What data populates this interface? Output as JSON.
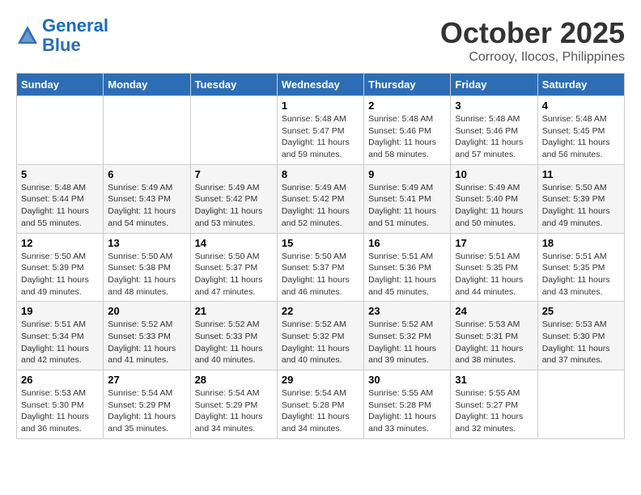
{
  "header": {
    "logo_line1": "General",
    "logo_line2": "Blue",
    "month": "October 2025",
    "location": "Corrooy, Ilocos, Philippines"
  },
  "weekdays": [
    "Sunday",
    "Monday",
    "Tuesday",
    "Wednesday",
    "Thursday",
    "Friday",
    "Saturday"
  ],
  "weeks": [
    [
      {
        "day": "",
        "info": ""
      },
      {
        "day": "",
        "info": ""
      },
      {
        "day": "",
        "info": ""
      },
      {
        "day": "1",
        "info": "Sunrise: 5:48 AM\nSunset: 5:47 PM\nDaylight: 11 hours\nand 59 minutes."
      },
      {
        "day": "2",
        "info": "Sunrise: 5:48 AM\nSunset: 5:46 PM\nDaylight: 11 hours\nand 58 minutes."
      },
      {
        "day": "3",
        "info": "Sunrise: 5:48 AM\nSunset: 5:46 PM\nDaylight: 11 hours\nand 57 minutes."
      },
      {
        "day": "4",
        "info": "Sunrise: 5:48 AM\nSunset: 5:45 PM\nDaylight: 11 hours\nand 56 minutes."
      }
    ],
    [
      {
        "day": "5",
        "info": "Sunrise: 5:48 AM\nSunset: 5:44 PM\nDaylight: 11 hours\nand 55 minutes."
      },
      {
        "day": "6",
        "info": "Sunrise: 5:49 AM\nSunset: 5:43 PM\nDaylight: 11 hours\nand 54 minutes."
      },
      {
        "day": "7",
        "info": "Sunrise: 5:49 AM\nSunset: 5:42 PM\nDaylight: 11 hours\nand 53 minutes."
      },
      {
        "day": "8",
        "info": "Sunrise: 5:49 AM\nSunset: 5:42 PM\nDaylight: 11 hours\nand 52 minutes."
      },
      {
        "day": "9",
        "info": "Sunrise: 5:49 AM\nSunset: 5:41 PM\nDaylight: 11 hours\nand 51 minutes."
      },
      {
        "day": "10",
        "info": "Sunrise: 5:49 AM\nSunset: 5:40 PM\nDaylight: 11 hours\nand 50 minutes."
      },
      {
        "day": "11",
        "info": "Sunrise: 5:50 AM\nSunset: 5:39 PM\nDaylight: 11 hours\nand 49 minutes."
      }
    ],
    [
      {
        "day": "12",
        "info": "Sunrise: 5:50 AM\nSunset: 5:39 PM\nDaylight: 11 hours\nand 49 minutes."
      },
      {
        "day": "13",
        "info": "Sunrise: 5:50 AM\nSunset: 5:38 PM\nDaylight: 11 hours\nand 48 minutes."
      },
      {
        "day": "14",
        "info": "Sunrise: 5:50 AM\nSunset: 5:37 PM\nDaylight: 11 hours\nand 47 minutes."
      },
      {
        "day": "15",
        "info": "Sunrise: 5:50 AM\nSunset: 5:37 PM\nDaylight: 11 hours\nand 46 minutes."
      },
      {
        "day": "16",
        "info": "Sunrise: 5:51 AM\nSunset: 5:36 PM\nDaylight: 11 hours\nand 45 minutes."
      },
      {
        "day": "17",
        "info": "Sunrise: 5:51 AM\nSunset: 5:35 PM\nDaylight: 11 hours\nand 44 minutes."
      },
      {
        "day": "18",
        "info": "Sunrise: 5:51 AM\nSunset: 5:35 PM\nDaylight: 11 hours\nand 43 minutes."
      }
    ],
    [
      {
        "day": "19",
        "info": "Sunrise: 5:51 AM\nSunset: 5:34 PM\nDaylight: 11 hours\nand 42 minutes."
      },
      {
        "day": "20",
        "info": "Sunrise: 5:52 AM\nSunset: 5:33 PM\nDaylight: 11 hours\nand 41 minutes."
      },
      {
        "day": "21",
        "info": "Sunrise: 5:52 AM\nSunset: 5:33 PM\nDaylight: 11 hours\nand 40 minutes."
      },
      {
        "day": "22",
        "info": "Sunrise: 5:52 AM\nSunset: 5:32 PM\nDaylight: 11 hours\nand 40 minutes."
      },
      {
        "day": "23",
        "info": "Sunrise: 5:52 AM\nSunset: 5:32 PM\nDaylight: 11 hours\nand 39 minutes."
      },
      {
        "day": "24",
        "info": "Sunrise: 5:53 AM\nSunset: 5:31 PM\nDaylight: 11 hours\nand 38 minutes."
      },
      {
        "day": "25",
        "info": "Sunrise: 5:53 AM\nSunset: 5:30 PM\nDaylight: 11 hours\nand 37 minutes."
      }
    ],
    [
      {
        "day": "26",
        "info": "Sunrise: 5:53 AM\nSunset: 5:30 PM\nDaylight: 11 hours\nand 36 minutes."
      },
      {
        "day": "27",
        "info": "Sunrise: 5:54 AM\nSunset: 5:29 PM\nDaylight: 11 hours\nand 35 minutes."
      },
      {
        "day": "28",
        "info": "Sunrise: 5:54 AM\nSunset: 5:29 PM\nDaylight: 11 hours\nand 34 minutes."
      },
      {
        "day": "29",
        "info": "Sunrise: 5:54 AM\nSunset: 5:28 PM\nDaylight: 11 hours\nand 34 minutes."
      },
      {
        "day": "30",
        "info": "Sunrise: 5:55 AM\nSunset: 5:28 PM\nDaylight: 11 hours\nand 33 minutes."
      },
      {
        "day": "31",
        "info": "Sunrise: 5:55 AM\nSunset: 5:27 PM\nDaylight: 11 hours\nand 32 minutes."
      },
      {
        "day": "",
        "info": ""
      }
    ]
  ]
}
